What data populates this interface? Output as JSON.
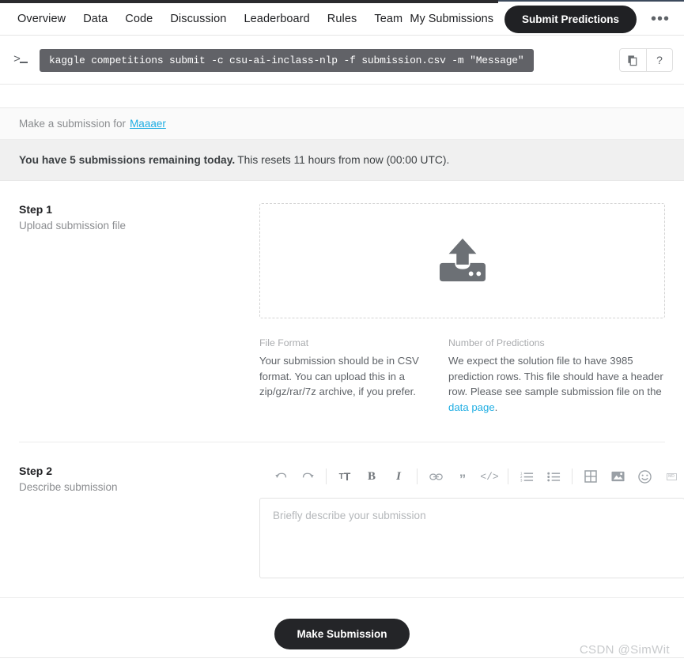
{
  "nav": {
    "items": [
      {
        "label": "Overview",
        "name": "tab-overview"
      },
      {
        "label": "Data",
        "name": "tab-data"
      },
      {
        "label": "Code",
        "name": "tab-code"
      },
      {
        "label": "Discussion",
        "name": "tab-discussion"
      },
      {
        "label": "Leaderboard",
        "name": "tab-leaderboard"
      },
      {
        "label": "Rules",
        "name": "tab-rules"
      },
      {
        "label": "Team",
        "name": "tab-team"
      }
    ],
    "my_submissions": "My Submissions",
    "submit_button": "Submit Predictions",
    "overflow_icon": "ellipsis-icon"
  },
  "command_bar": {
    "prompt_icon": "terminal-prompt-icon",
    "command": "kaggle competitions submit -c csu-ai-inclass-nlp -f submission.csv -m \"Message\"",
    "copy_icon": "copy-icon",
    "help_label": "?"
  },
  "card": {
    "header_prefix": "Make a submission for",
    "competition_link": "Maaaer",
    "banner_bold": "You have 5 submissions remaining today.",
    "banner_rest": "This resets 11 hours from now (00:00 UTC)."
  },
  "step1": {
    "title": "Step 1",
    "subtitle": "Upload submission file",
    "dropzone_icon": "upload-icon",
    "file_format_heading": "File Format",
    "file_format_body": "Your submission should be in CSV format. You can upload this in a zip/gz/rar/7z archive, if you prefer.",
    "predictions_heading": "Number of Predictions",
    "predictions_body_1": "We expect the solution file to have 3985 prediction rows. This file should have a header row. Please see sample submission file on the ",
    "predictions_link": "data page",
    "predictions_body_2": "."
  },
  "step2": {
    "title": "Step 2",
    "subtitle": "Describe submission",
    "placeholder": "Briefly describe your submission",
    "toolbar": [
      {
        "name": "undo-icon",
        "label": "undo"
      },
      {
        "name": "redo-icon",
        "label": "redo"
      },
      {
        "name": "text-size-icon",
        "label": "T"
      },
      {
        "name": "bold-icon",
        "label": "B"
      },
      {
        "name": "italic-icon",
        "label": "I"
      },
      {
        "name": "link-icon",
        "label": "link"
      },
      {
        "name": "quote-icon",
        "label": "”"
      },
      {
        "name": "code-icon",
        "label": "<>"
      },
      {
        "name": "ordered-list-icon",
        "label": "ordered list"
      },
      {
        "name": "bullet-list-icon",
        "label": "bullet list"
      },
      {
        "name": "table-icon",
        "label": "table"
      },
      {
        "name": "image-icon",
        "label": "image"
      },
      {
        "name": "emoji-icon",
        "label": "emoji"
      },
      {
        "name": "markdown-icon",
        "label": "MD"
      }
    ]
  },
  "footer": {
    "make_submission": "Make Submission"
  },
  "watermark": "CSDN @SimWit",
  "colors": {
    "accent_link": "#20aee3",
    "dark_button": "#202124",
    "command_bg": "#616267",
    "banner_bg": "#f0f0f0"
  }
}
